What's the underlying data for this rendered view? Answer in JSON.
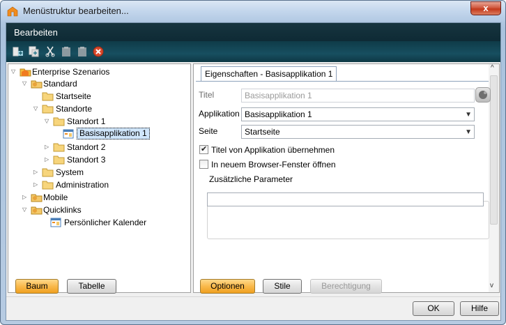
{
  "window": {
    "title": "Menüstruktur bearbeiten...",
    "close_glyph": "x"
  },
  "menu": {
    "edit_label": "Bearbeiten"
  },
  "toolbar": {
    "icons": [
      "add-item-icon",
      "copy-item-icon",
      "cut-icon",
      "paste-icon",
      "paste-below-icon",
      "delete-icon"
    ]
  },
  "tree": {
    "items": [
      {
        "label": "Enterprise Szenarios"
      },
      {
        "label": "Standard"
      },
      {
        "label": "Startseite"
      },
      {
        "label": "Standorte"
      },
      {
        "label": "Standort 1"
      },
      {
        "label": "Basisapplikation 1"
      },
      {
        "label": "Standort 2"
      },
      {
        "label": "Standort 3"
      },
      {
        "label": "System"
      },
      {
        "label": "Administration"
      },
      {
        "label": "Mobile"
      },
      {
        "label": "Quicklinks"
      },
      {
        "label": "Persönlicher Kalender"
      }
    ]
  },
  "tab": {
    "title": "Eigenschaften - Basisapplikation 1"
  },
  "form": {
    "titel_label": "Titel",
    "titel_value": "Basisapplikation 1",
    "applikation_label": "Applikation",
    "applikation_value": "Basisapplikation 1",
    "seite_label": "Seite",
    "seite_value": "Startseite",
    "chk_titel_label": "Titel von Applikation übernehmen",
    "chk_titel_checked": true,
    "chk_browser_label": "In neuem Browser-Fenster öffnen",
    "chk_browser_checked": false,
    "param_legend": "Zusätzliche Parameter",
    "param_value": ""
  },
  "left_buttons": {
    "baum": "Baum",
    "tabelle": "Tabelle"
  },
  "right_buttons": {
    "optionen": "Optionen",
    "stile": "Stile",
    "berechtigung": "Berechtigung"
  },
  "footer": {
    "ok": "OK",
    "hilfe": "Hilfe"
  },
  "colors": {
    "accent_orange": "#f9b94c",
    "menubar": "#0e2a35",
    "selection": "#cfe5fb"
  }
}
